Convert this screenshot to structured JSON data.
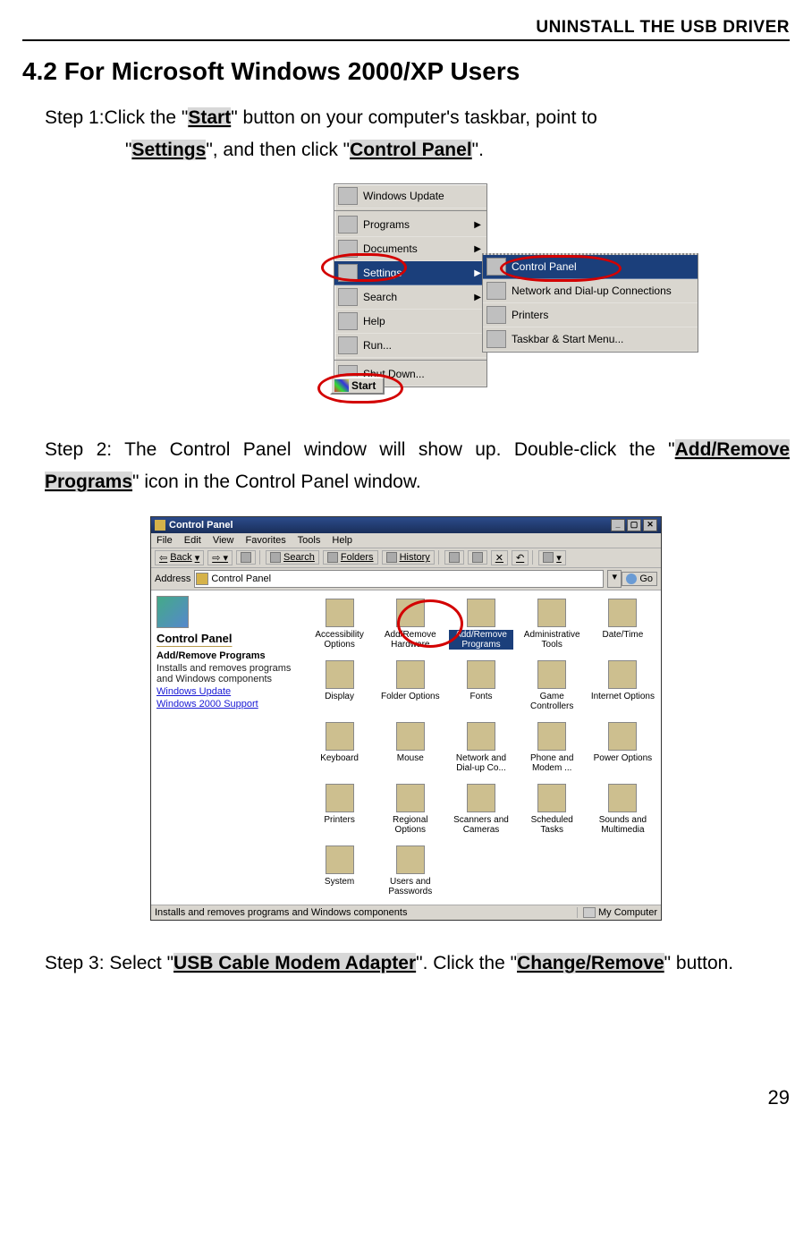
{
  "header": {
    "right": "UNINSTALL THE USB DRIVER"
  },
  "section_title": "4.2 For Microsoft Windows 2000/XP Users",
  "step1": {
    "prefix": "Step  1:Click  the  \"",
    "k1": "Start",
    "mid1": "\"  button  on  your  computer's  taskbar,  point  to",
    "k2": "Settings",
    "mid2": "\", and then click \"",
    "k3": "Control Panel",
    "suffix": "\"."
  },
  "step2": {
    "prefix": "Step  2:  The  Control  Panel  window  will  show  up.  Double-click  the \"",
    "k1": "Add/Remove Programs",
    "suffix": "\" icon in the Control Panel window."
  },
  "step3": {
    "prefix": "Step 3: Select \"",
    "k1": "USB Cable Modem Adapter",
    "mid1": "\". Click the \"",
    "k2": "Change/Remove",
    "suffix": "\" button."
  },
  "fig1": {
    "items": [
      "Windows Update",
      "Programs",
      "Documents",
      "Settings",
      "Search",
      "Help",
      "Run...",
      "Shut Down..."
    ],
    "settings_idx": 3,
    "submenu": [
      "Control Panel",
      "Network and Dial-up Connections",
      "Printers",
      "Taskbar & Start Menu..."
    ],
    "submenu_sel": 0,
    "start_label": "Start"
  },
  "fig2": {
    "title": "Control Panel",
    "menus": [
      "File",
      "Edit",
      "View",
      "Favorites",
      "Tools",
      "Help"
    ],
    "toolbar": {
      "back": "Back",
      "search": "Search",
      "folders": "Folders",
      "history": "History"
    },
    "address_label": "Address",
    "address_value": "Control Panel",
    "go_label": "Go",
    "sidebar": {
      "title": "Control Panel",
      "subtitle": "Add/Remove Programs",
      "desc": "Installs and removes programs and Windows components",
      "links": [
        "Windows Update",
        "Windows 2000 Support"
      ]
    },
    "items": [
      "Accessibility Options",
      "Add/Remove Hardware",
      "Add/Remove Programs",
      "Administrative Tools",
      "Date/Time",
      "Display",
      "Folder Options",
      "Fonts",
      "Game Controllers",
      "Internet Options",
      "Keyboard",
      "Mouse",
      "Network and Dial-up Co...",
      "Phone and Modem ...",
      "Power Options",
      "Printers",
      "Regional Options",
      "Scanners and Cameras",
      "Scheduled Tasks",
      "Sounds and Multimedia",
      "System",
      "Users and Passwords"
    ],
    "selected_idx": 2,
    "status_left": "Installs and removes programs and Windows components",
    "status_right": "My Computer"
  },
  "page_number": "29"
}
